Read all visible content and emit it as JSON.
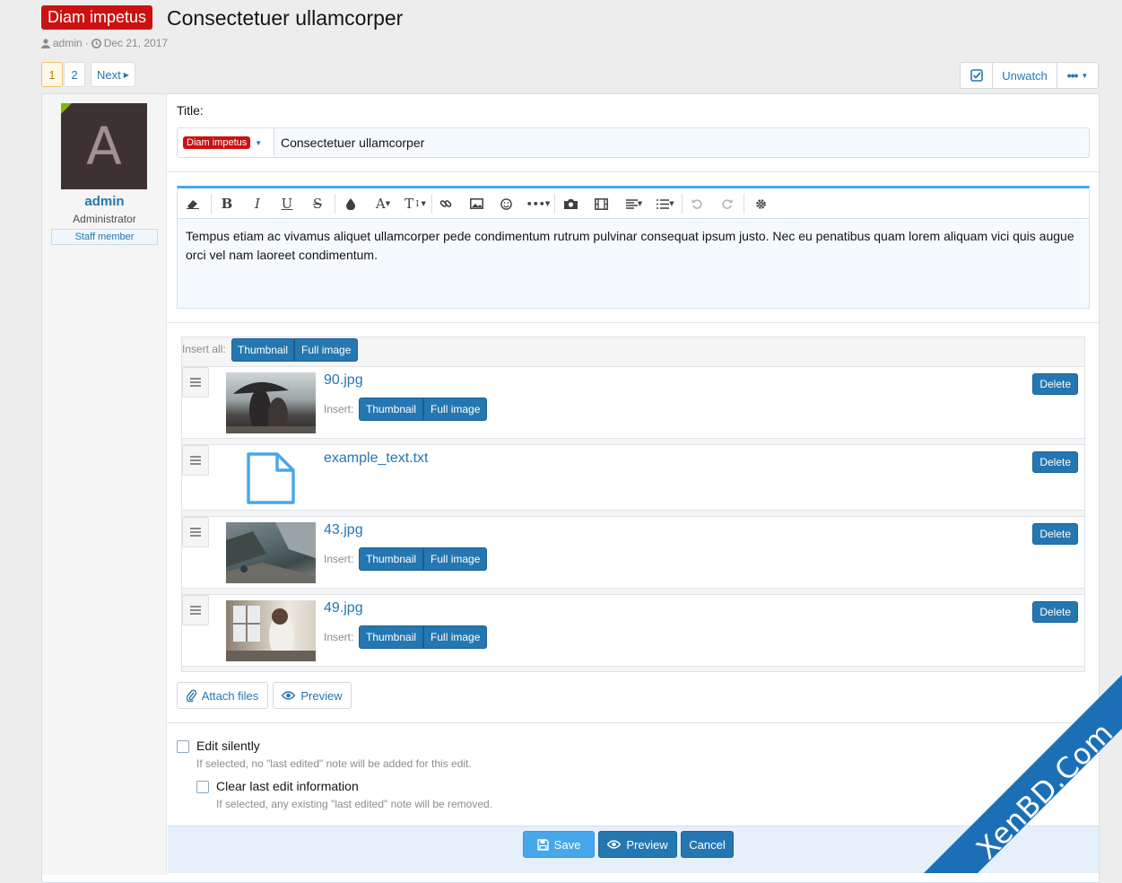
{
  "thread": {
    "prefix": "Diam impetus",
    "title": "Consectetuer ullamcorper",
    "author": "admin",
    "date": "Dec 21, 2017"
  },
  "pagination": {
    "pages": [
      "1",
      "2"
    ],
    "next_label": "Next"
  },
  "actions": {
    "unwatch_label": "Unwatch"
  },
  "user": {
    "avatar_letter": "A",
    "name": "admin",
    "title": "Administrator",
    "banner": "Staff member"
  },
  "editor": {
    "title_label": "Title:",
    "prefix": "Diam impetus",
    "title_value": "Consectetuer ullamcorper",
    "toolbar_icons": [
      "eraser-icon",
      "bold-icon",
      "italic-icon",
      "underline-icon",
      "strikethrough-icon",
      "color-icon",
      "font-family-icon",
      "font-size-icon",
      "link-icon",
      "image-icon",
      "smilie-icon",
      "more-icon",
      "camera-icon",
      "media-icon",
      "align-icon",
      "list-icon",
      "undo-icon",
      "redo-icon",
      "settings-icon"
    ],
    "body": "Tempus etiam ac vivamus aliquet ullamcorper pede condimentum rutrum pulvinar consequat ipsum justo. Nec eu penatibus quam lorem aliquam vici quis augue orci vel nam laoreet condimentum."
  },
  "attachments": {
    "insert_all_label": "Insert all:",
    "insert_label": "Insert:",
    "thumbnail_label": "Thumbnail",
    "full_image_label": "Full image",
    "delete_label": "Delete",
    "items": [
      {
        "name": "90.jpg",
        "type": "image"
      },
      {
        "name": "example_text.txt",
        "type": "file"
      },
      {
        "name": "43.jpg",
        "type": "image"
      },
      {
        "name": "49.jpg",
        "type": "image"
      }
    ]
  },
  "form": {
    "attach_files_label": "Attach files",
    "preview_label": "Preview",
    "edit_silently_label": "Edit silently",
    "edit_silently_hint": "If selected, no \"last edited\" note will be added for this edit.",
    "clear_edit_label": "Clear last edit information",
    "clear_edit_hint": "If selected, any existing \"last edited\" note will be removed.",
    "save_label": "Save",
    "preview_button_label": "Preview",
    "cancel_label": "Cancel"
  },
  "watermark": "XenBD.Com",
  "colors": {
    "accent": "#2577b1",
    "prefix": "#cc1111",
    "watermark": "#1a6fb7",
    "online": "#7fb900"
  }
}
